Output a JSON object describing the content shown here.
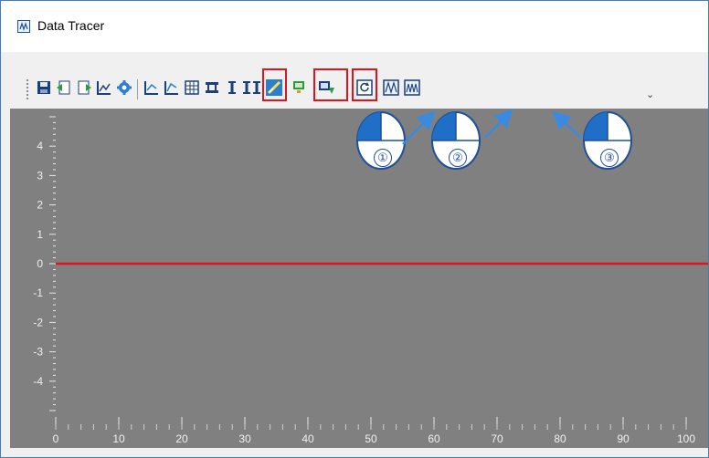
{
  "window": {
    "title": "Data Tracer"
  },
  "toolbar": {
    "buttons": [
      "save",
      "import",
      "export",
      "chart-settings",
      "settings",
      "zoom-x",
      "zoom-y",
      "table",
      "fit",
      "cursor-1",
      "cursor-2",
      "connect",
      "monitor",
      "download",
      "refresh",
      "waveform-1",
      "waveform-2"
    ],
    "overflow": "⌄"
  },
  "callouts": [
    "①",
    "②",
    "③"
  ],
  "chart_data": {
    "type": "line",
    "x": [
      0,
      100
    ],
    "series": [
      {
        "values": [
          0,
          0
        ],
        "color": "#e0141e"
      }
    ],
    "y_ticks": [
      "4",
      "3",
      "2",
      "1",
      "0",
      "-1",
      "-2",
      "-3",
      "-4"
    ],
    "x_ticks": [
      "0",
      "10",
      "20",
      "30",
      "40",
      "50",
      "60",
      "70",
      "80",
      "90",
      "100"
    ],
    "ylim": [
      -5,
      5
    ],
    "xlim": [
      0,
      100
    ],
    "background": "#808080"
  }
}
